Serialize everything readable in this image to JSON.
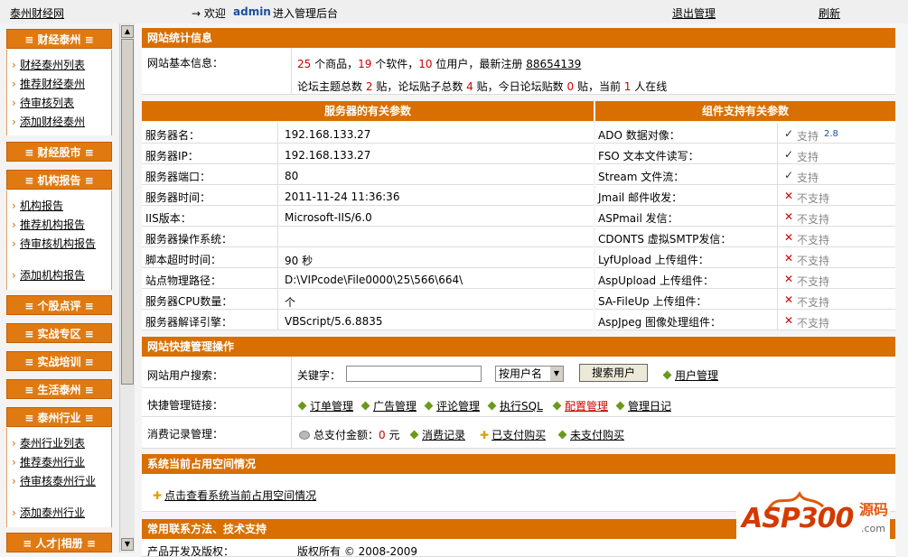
{
  "topbar": {
    "site": "泰州财经网",
    "welcome_arrow": "→ 欢迎",
    "user": "admin",
    "welcome_suffix": "进入管理后台",
    "logout": "退出管理",
    "refresh": "刷新"
  },
  "sidebar": {
    "caijing": {
      "title": "财经泰州",
      "items": [
        "财经泰州列表",
        "推荐财经泰州",
        "待审核列表",
        "添加财经泰州"
      ]
    },
    "gushi": {
      "title": "财经股市"
    },
    "jigou": {
      "title": "机构报告",
      "items": [
        "机构报告",
        "推荐机构报告",
        "待审核机构报告",
        "添加机构报告"
      ]
    },
    "gegu": {
      "title": "个股点评"
    },
    "shizhan": {
      "title": "实战专区"
    },
    "peixun": {
      "title": "实战培训"
    },
    "shenghuo": {
      "title": "生活泰州"
    },
    "hangye": {
      "title": "泰州行业",
      "items": [
        "泰州行业列表",
        "推荐泰州行业",
        "待审核泰州行业",
        "添加泰州行业"
      ]
    },
    "rencai": {
      "title": "人才|相册"
    }
  },
  "stats": {
    "title": "网站统计信息",
    "basic_label": "网站基本信息：",
    "products": "25",
    "products_unit": "个商品，",
    "software": "19",
    "software_unit": "个软件，",
    "users": "10",
    "users_unit": "位用户，最新注册",
    "latest_user": "88654139",
    "forum_prefix": "论坛主题总数",
    "topics": "2",
    "topics_unit": "贴，论坛贴子总数",
    "posts": "4",
    "posts_unit": "贴，今日论坛贴数",
    "today": "0",
    "today_unit": "贴，当前",
    "online": "1",
    "online_unit": "人在线"
  },
  "server": {
    "header": "服务器的有关参数",
    "rows": [
      {
        "label": "服务器名：",
        "value": "192.168.133.27"
      },
      {
        "label": "服务器IP：",
        "value": "192.168.133.27"
      },
      {
        "label": "服务器端口：",
        "value": "80"
      },
      {
        "label": "服务器时间：",
        "value": "2011-11-24 11:36:36"
      },
      {
        "label": "IIS版本：",
        "value": "Microsoft-IIS/6.0"
      },
      {
        "label": "服务器操作系统：",
        "value": ""
      },
      {
        "label": "脚本超时时间：",
        "value": "90 秒"
      },
      {
        "label": "站点物理路径：",
        "value": "D:\\VIPcode\\File0000\\25\\566\\664\\"
      },
      {
        "label": "服务器CPU数量：",
        "value": "个"
      },
      {
        "label": "服务器解译引擎：",
        "value": "VBScript/5.6.8835"
      }
    ]
  },
  "components": {
    "header": "组件支持有关参数",
    "rows": [
      {
        "label": "ADO 数据对像：",
        "mark": "✓",
        "status": "支持",
        "extra": "2.8",
        "ok": true
      },
      {
        "label": "FSO 文本文件读写：",
        "mark": "✓",
        "status": "支持",
        "extra": "",
        "ok": true
      },
      {
        "label": "Stream 文件流：",
        "mark": "✓",
        "status": "支持",
        "extra": "",
        "ok": true
      },
      {
        "label": "Jmail 邮件收发：",
        "mark": "✕",
        "status": "不支持",
        "extra": "",
        "ok": false
      },
      {
        "label": "ASPmail 发信：",
        "mark": "✕",
        "status": "不支持",
        "extra": "",
        "ok": false
      },
      {
        "label": "CDONTS 虚拟SMTP发信：",
        "mark": "✕",
        "status": "不支持",
        "extra": "",
        "ok": false
      },
      {
        "label": "LyfUpload 上传组件：",
        "mark": "✕",
        "status": "不支持",
        "extra": "",
        "ok": false
      },
      {
        "label": "AspUpload 上传组件：",
        "mark": "✕",
        "status": "不支持",
        "extra": "",
        "ok": false
      },
      {
        "label": "SA-FileUp 上传组件：",
        "mark": "✕",
        "status": "不支持",
        "extra": "",
        "ok": false
      },
      {
        "label": "AspJpeg 图像处理组件：",
        "mark": "✕",
        "status": "不支持",
        "extra": "",
        "ok": false
      }
    ]
  },
  "quick": {
    "title": "网站快捷管理操作",
    "search_label": "网站用户搜索：",
    "keyword_label": "关键字：",
    "keyword_value": "",
    "select_value": "按用户名",
    "search_button": "搜索用户",
    "user_manage": "用户管理",
    "links_label": "快捷管理链接：",
    "links": [
      "订单管理",
      "广告管理",
      "评论管理",
      "执行SQL",
      "配置管理",
      "管理日记"
    ],
    "consume_label": "消费记录管理：",
    "paid_total_label": "总支付金额：",
    "paid_total": "0",
    "paid_total_unit": "元",
    "consume_records": "消费记录",
    "paid_buy": "已支付购买",
    "unpaid_buy": "未支付购买"
  },
  "space": {
    "title": "系统当前占用空间情况",
    "link": "点击查看系统当前占用空间情况"
  },
  "contact": {
    "title": "常用联系方法、技术支持",
    "dev_label": "产品开发及版权：",
    "copyright": "版权所有 © 2008-2009"
  },
  "watermark": {
    "brand": "ASP300",
    "cn": "源码",
    "domain": ".com"
  },
  "colors": {
    "accent": "#d86f00",
    "red": "#d00000",
    "link_blue": "#1a4fa0"
  }
}
